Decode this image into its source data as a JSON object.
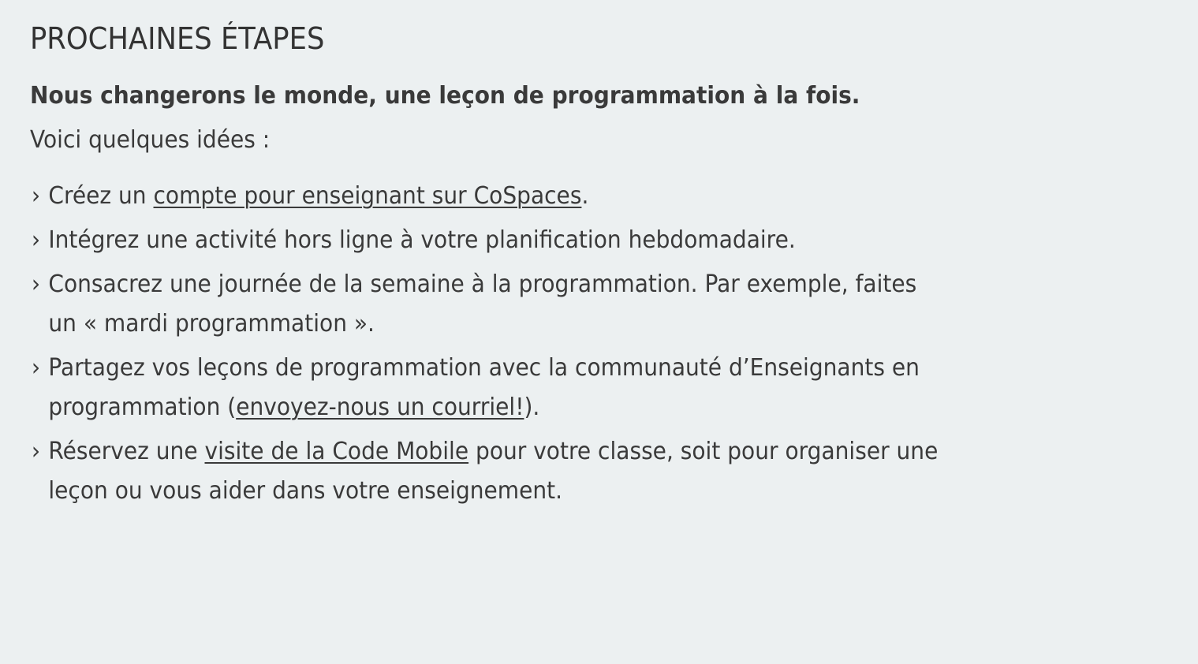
{
  "header": {
    "title": "PROCHAINES ÉTAPES"
  },
  "intro": {
    "bold_line": "Nous changerons le monde, une leçon de programmation à la fois.",
    "sub_line": "Voici quelques idées :"
  },
  "bullet_glyph": "›",
  "items": [
    {
      "before": "Créez un ",
      "link": "compte pour enseignant sur CoSpaces",
      "after": "."
    },
    {
      "text": "Intégrez une activité hors ligne à votre planification hebdomadaire."
    },
    {
      "line1": "Consacrez une journée de la semaine à la programmation. Par exemple, faites",
      "line2": "un « mardi programmation »."
    },
    {
      "line1": "Partagez vos leçons de programmation avec la communauté d’Enseignants en",
      "line2_before": "programmation (",
      "link": "envoyez-nous un courriel!",
      "line2_after": ")."
    },
    {
      "before": "Réservez une ",
      "link": "visite de la Code Mobile",
      "after": " pour votre classe, soit pour organiser une",
      "line2": "leçon ou vous aider dans votre enseignement."
    }
  ]
}
